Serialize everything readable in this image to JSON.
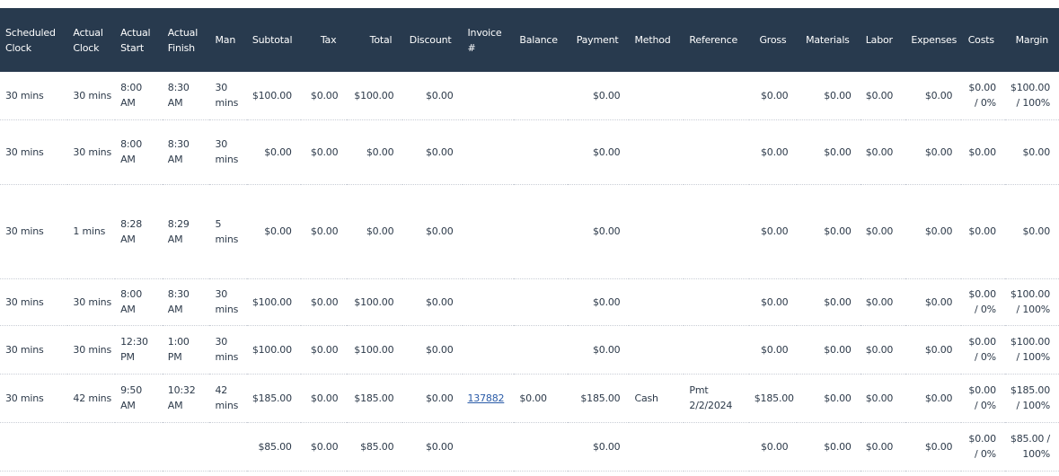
{
  "columns": [
    "Scheduled Clock",
    "Actual Clock",
    "Actual Start",
    "Actual Finish",
    "Man",
    "Subtotal",
    "Tax",
    "Total",
    "Discount",
    "Invoice #",
    "Balance",
    "Payment",
    "Method",
    "Reference",
    "Gross",
    "Materials",
    "Labor",
    "Expenses",
    "Costs",
    "Margin"
  ],
  "rows": [
    {
      "sched": "30 mins",
      "aclock": "30 mins",
      "astart": "8:00 AM",
      "afinish": "8:30 AM",
      "man": "30 mins",
      "subtotal": "$100.00",
      "tax": "$0.00",
      "total": "$100.00",
      "discount": "$0.00",
      "invoice": "",
      "balance": "",
      "payment": "$0.00",
      "method": "",
      "reference": "",
      "gross": "$0.00",
      "materials": "$0.00",
      "labor": "$0.00",
      "expenses": "$0.00",
      "costs": "$0.00 / 0%",
      "margin": "$100.00 / 100%"
    },
    {
      "sched": "30 mins",
      "aclock": "30 mins",
      "astart": "8:00 AM",
      "afinish": "8:30 AM",
      "man": "30 mins",
      "subtotal": "$0.00",
      "tax": "$0.00",
      "total": "$0.00",
      "discount": "$0.00",
      "invoice": "",
      "balance": "",
      "payment": "$0.00",
      "method": "",
      "reference": "",
      "gross": "$0.00",
      "materials": "$0.00",
      "labor": "$0.00",
      "expenses": "$0.00",
      "costs": "$0.00",
      "margin": "$0.00"
    },
    {
      "sched": "30 mins",
      "aclock": "1 mins",
      "astart": "8:28 AM",
      "afinish": "8:29 AM",
      "man": "5 mins",
      "subtotal": "$0.00",
      "tax": "$0.00",
      "total": "$0.00",
      "discount": "$0.00",
      "invoice": "",
      "balance": "",
      "payment": "$0.00",
      "method": "",
      "reference": "",
      "gross": "$0.00",
      "materials": "$0.00",
      "labor": "$0.00",
      "expenses": "$0.00",
      "costs": "$0.00",
      "margin": "$0.00"
    },
    {
      "sched": "30 mins",
      "aclock": "30 mins",
      "astart": "8:00 AM",
      "afinish": "8:30 AM",
      "man": "30 mins",
      "subtotal": "$100.00",
      "tax": "$0.00",
      "total": "$100.00",
      "discount": "$0.00",
      "invoice": "",
      "balance": "",
      "payment": "$0.00",
      "method": "",
      "reference": "",
      "gross": "$0.00",
      "materials": "$0.00",
      "labor": "$0.00",
      "expenses": "$0.00",
      "costs": "$0.00 / 0%",
      "margin": "$100.00 / 100%"
    },
    {
      "sched": "30 mins",
      "aclock": "30 mins",
      "astart": "12:30 PM",
      "afinish": "1:00 PM",
      "man": "30 mins",
      "subtotal": "$100.00",
      "tax": "$0.00",
      "total": "$100.00",
      "discount": "$0.00",
      "invoice": "",
      "balance": "",
      "payment": "$0.00",
      "method": "",
      "reference": "",
      "gross": "$0.00",
      "materials": "$0.00",
      "labor": "$0.00",
      "expenses": "$0.00",
      "costs": "$0.00 / 0%",
      "margin": "$100.00 / 100%"
    },
    {
      "sched": "30 mins",
      "aclock": "42 mins",
      "astart": "9:50 AM",
      "afinish": "10:32 AM",
      "man": "42 mins",
      "subtotal": "$185.00",
      "tax": "$0.00",
      "total": "$185.00",
      "discount": "$0.00",
      "invoice": "137882",
      "balance": "$0.00",
      "payment": "$185.00",
      "method": "Cash",
      "reference": "Pmt 2/2/2024",
      "gross": "$185.00",
      "materials": "$0.00",
      "labor": "$0.00",
      "expenses": "$0.00",
      "costs": "$0.00 / 0%",
      "margin": "$185.00 / 100%"
    },
    {
      "sched": "",
      "aclock": "",
      "astart": "",
      "afinish": "",
      "man": "",
      "subtotal": "$85.00",
      "tax": "$0.00",
      "total": "$85.00",
      "discount": "$0.00",
      "invoice": "",
      "balance": "",
      "payment": "$0.00",
      "method": "",
      "reference": "",
      "gross": "$0.00",
      "materials": "$0.00",
      "labor": "$0.00",
      "expenses": "$0.00",
      "costs": "$0.00 / 0%",
      "margin": "$85.00 / 100%"
    }
  ]
}
